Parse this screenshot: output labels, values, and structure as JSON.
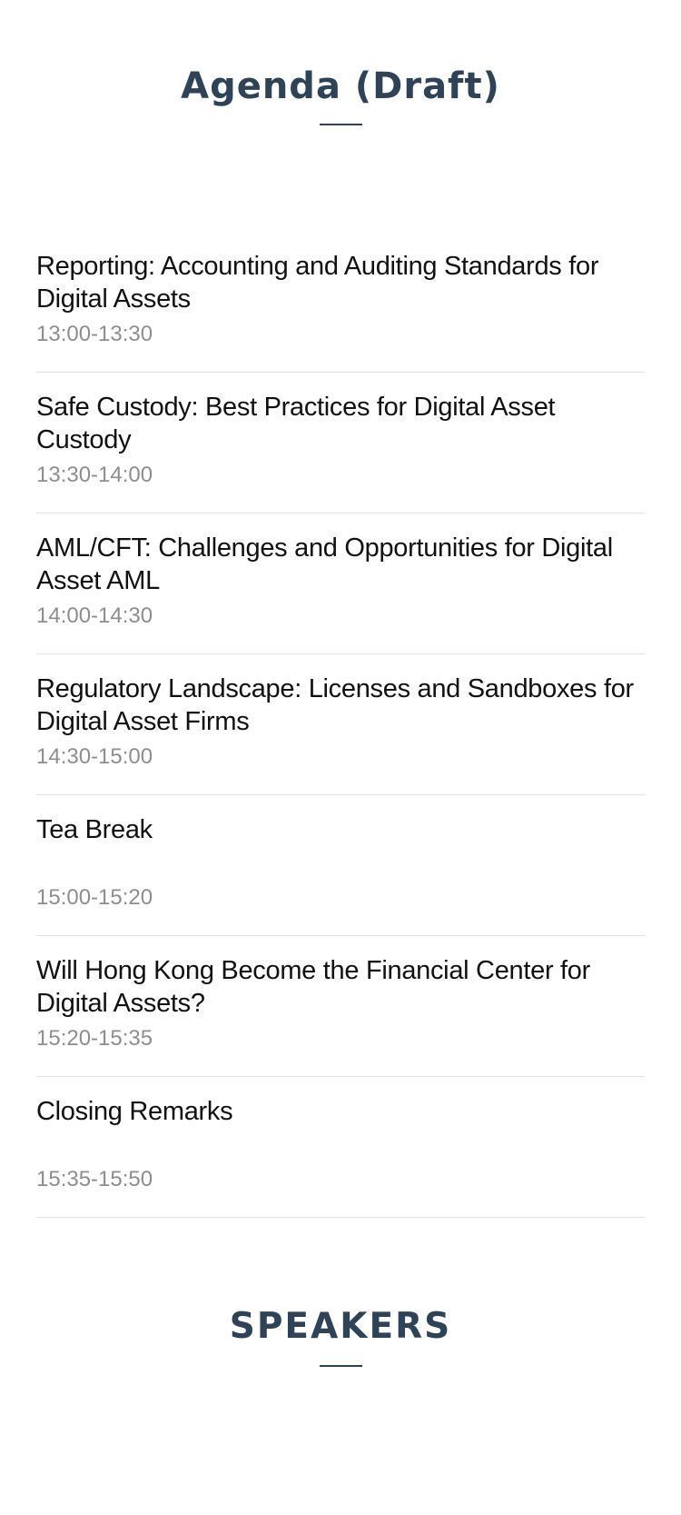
{
  "agenda": {
    "title": "Agenda (Draft)",
    "items": [
      {
        "title": "Reporting: Accounting and Auditing Standards for Digital Assets",
        "time": "13:00-13:30"
      },
      {
        "title": "Safe Custody: Best Practices for Digital Asset Custody",
        "time": "13:30-14:00"
      },
      {
        "title": "AML/CFT: Challenges and Opportunities for Digital Asset AML",
        "time": "14:00-14:30"
      },
      {
        "title": "Regulatory Landscape: Licenses and Sandboxes for Digital Asset Firms",
        "time": "14:30-15:00"
      },
      {
        "title": "Tea Break",
        "time": "15:00-15:20"
      },
      {
        "title": "Will Hong Kong Become the Financial Center for Digital Assets?",
        "time": "15:20-15:35"
      },
      {
        "title": "Closing Remarks",
        "time": "15:35-15:50"
      }
    ]
  },
  "speakers": {
    "title": "SPEAKERS"
  },
  "colors": {
    "heading": "#2e4358",
    "item_title": "#111111",
    "item_time": "#8e8e8e",
    "divider": "#e3e3e3"
  }
}
